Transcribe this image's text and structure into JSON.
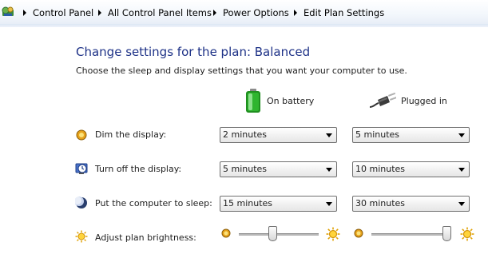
{
  "breadcrumb": {
    "items": [
      "Control Panel",
      "All Control Panel Items",
      "Power Options",
      "Edit Plan Settings"
    ]
  },
  "page": {
    "title": "Change settings for the plan: Balanced",
    "subtitle": "Choose the sleep and display settings that you want your computer to use."
  },
  "columns": {
    "battery": "On battery",
    "plugged": "Plugged in"
  },
  "settings": {
    "dim": {
      "label": "Dim the display:",
      "battery": "2 minutes",
      "plugged": "5 minutes"
    },
    "off": {
      "label": "Turn off the display:",
      "battery": "5 minutes",
      "plugged": "10 minutes"
    },
    "sleep": {
      "label": "Put the computer to sleep:",
      "battery": "15 minutes",
      "plugged": "30 minutes"
    }
  },
  "brightness": {
    "label": "Adjust plan brightness:",
    "battery_level": 0.42,
    "plugged_level": 1.0
  },
  "colors": {
    "title": "#1e3287",
    "battery_green": "#2fb52f",
    "sun_yellow": "#f2b705"
  },
  "icons": {
    "address": "control-panel-icon",
    "separator": "chevron-right-icon",
    "battery": "battery-icon",
    "plug": "plug-icon",
    "dim": "dim-display-icon",
    "off": "display-timer-icon",
    "sleep": "moon-sleep-icon",
    "brightness": "sun-icon"
  }
}
